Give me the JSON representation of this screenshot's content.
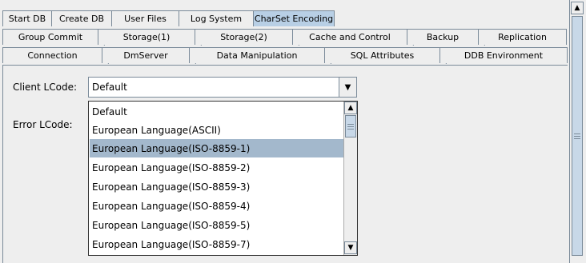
{
  "tabs": {
    "row1": [
      "Start DB",
      "Create DB",
      "User Files",
      "Log System",
      "CharSet Encoding"
    ],
    "row2": [
      "Group Commit",
      "Storage(1)",
      "Storage(2)",
      "Cache and Control",
      "Backup",
      "Replication"
    ],
    "row3": [
      "Connection",
      "DmServer",
      "Data Manipulation",
      "SQL Attributes",
      "DDB Environment"
    ],
    "active": "CharSet Encoding"
  },
  "form": {
    "client_lcode_label": "Client LCode:",
    "client_lcode_value": "Default",
    "error_lcode_label": "Error LCode:"
  },
  "dropdown": {
    "options": [
      "Default",
      "European Language(ASCII)",
      "European Language(ISO-8859-1)",
      "European Language(ISO-8859-2)",
      "European Language(ISO-8859-3)",
      "European Language(ISO-8859-4)",
      "European Language(ISO-8859-5)",
      "European Language(ISO-8859-7)"
    ],
    "selected_index": 2
  },
  "colors": {
    "active_tab": "#b8cfe5",
    "selected_option": "#a3b8cc"
  }
}
